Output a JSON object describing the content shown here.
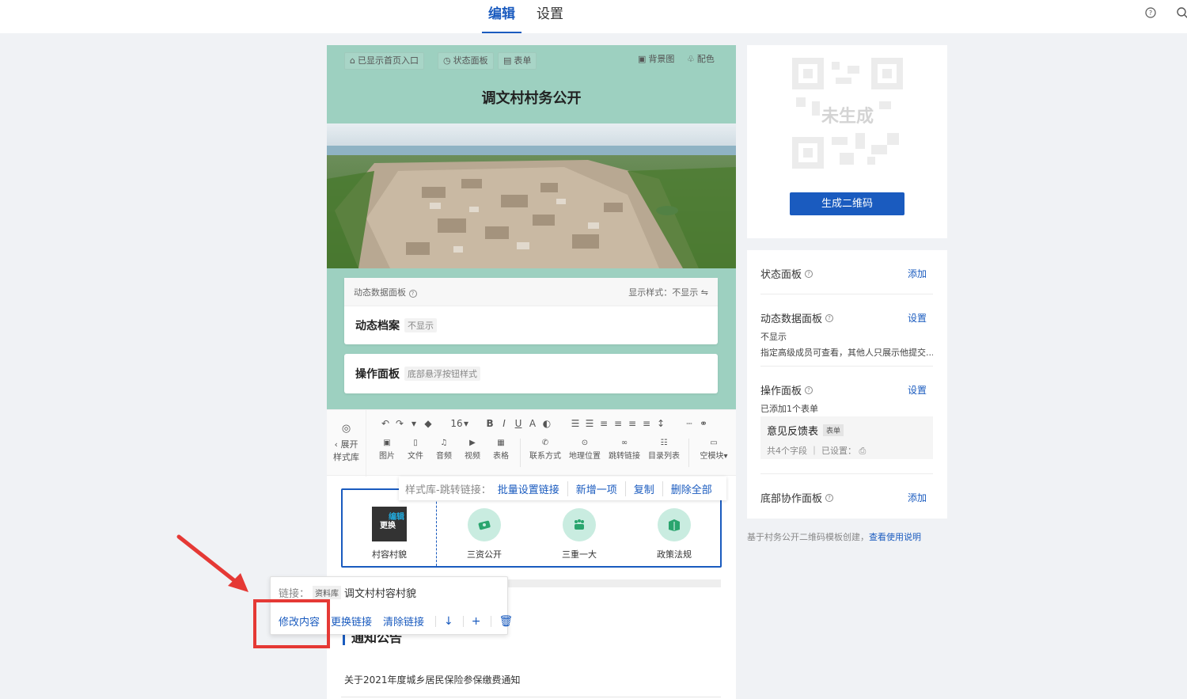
{
  "topbar": {
    "tabs": [
      "编辑",
      "设置"
    ]
  },
  "canvas": {
    "chips": [
      "已显示首页入口",
      "状态面板",
      "表单"
    ],
    "right_chips": [
      "背景图",
      "配色"
    ],
    "title": "调文村村务公开",
    "dynamic_panel": {
      "header_label": "动态数据面板",
      "display_style": "显示样式：不显示",
      "title": "动态档案",
      "tag": "不显示"
    },
    "operation_panel": {
      "title": "操作面板",
      "tag": "底部悬浮按钮样式"
    }
  },
  "toolbar": {
    "left_label": "展开",
    "left_label2": "样式库",
    "font_size": "16",
    "row1": [
      "B",
      "I",
      "U",
      "A"
    ],
    "items": [
      "图片",
      "文件",
      "音频",
      "视频",
      "表格",
      "联系方式",
      "地理位置",
      "跳转链接",
      "目录列表",
      "空模块"
    ]
  },
  "linkbar": {
    "label": "样式库-跳转链接：",
    "actions": [
      "批量设置链接",
      "新增一项",
      "复制",
      "删除全部"
    ]
  },
  "nav": {
    "thumb_edit": "编辑",
    "thumb_replace": "更换",
    "items": [
      "村容村貌",
      "三资公开",
      "三重一大",
      "政策法规"
    ]
  },
  "notice": {
    "title": "通知公告",
    "item": "关于2021年度城乡居民保险参保缴费通知"
  },
  "popup": {
    "link_label": "链接：",
    "source": "资料库",
    "link_value": "调文村村容村貌",
    "actions": [
      "修改内容",
      "更换链接",
      "清除链接"
    ]
  },
  "qr": {
    "placeholder": "未生成",
    "button": "生成二维码"
  },
  "settings": {
    "status_panel": {
      "title": "状态面板",
      "action": "添加"
    },
    "dynamic_panel": {
      "title": "动态数据面板",
      "action": "设置",
      "sub": "不显示",
      "sub2": "指定高级成员可查看，其他人只展示他提交..."
    },
    "operation_panel": {
      "title": "操作面板",
      "action": "设置",
      "sub": "已添加1个表单"
    },
    "form": {
      "name": "意见反馈表",
      "tag": "表单",
      "meta": "共4个字段 ｜ 已设置："
    },
    "bottom_panel": {
      "title": "底部协作面板",
      "action": "添加"
    }
  },
  "footnote": {
    "text": "基于村务公开二维码模板创建，",
    "link": "查看使用说明"
  },
  "colors": {
    "accent": "#1a5bbf",
    "teal": "#9dd0c0",
    "highlight": "#e53935"
  }
}
